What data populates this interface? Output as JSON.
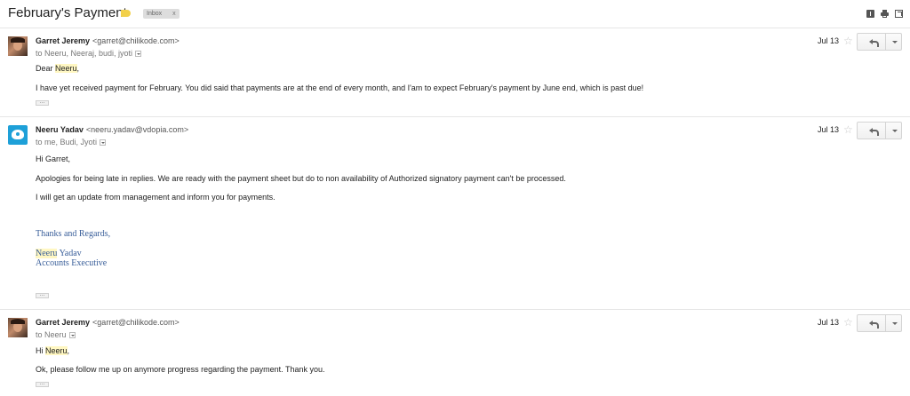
{
  "thread": {
    "subject": "February's Payment",
    "label_chip": "Inbox",
    "label_chip_close": "x",
    "label_color": "#f2d04a"
  },
  "toolbar_icons": [
    "info-icon",
    "print-icon",
    "new-window-icon"
  ],
  "messages": [
    {
      "sender_name": "Garret Jeremy",
      "sender_email": "<garret@chilikode.com>",
      "recipients": "to Neeru, Neeraj, budi, jyoti",
      "date": "Jul 13",
      "avatar": "user-photo",
      "body": {
        "greeting_pre": "Dear ",
        "greeting_name": "Neeru",
        "greeting_post": ",",
        "line1": "I have yet received payment for February. You did said that payments are at the end of every month, and I'am to expect February's payment by June end, which is past due!"
      },
      "ellipsis": "..."
    },
    {
      "sender_name": "Neeru Yadav",
      "sender_email": "<neeru.yadav@vdopia.com>",
      "recipients": "to me, Budi, Jyoti",
      "date": "Jul 13",
      "avatar": "company-logo",
      "body": {
        "greeting": "Hi Garret,",
        "line1": "Apologies for being late in replies. We are ready with the payment sheet but do to non availability of Authorized signatory payment can't be processed.",
        "line2": "I will get an update from management and inform you for payments.",
        "sig_regards": "Thanks and Regards,",
        "sig_first": "Neeru",
        "sig_last": " Yadav",
        "sig_title": "Accounts Executive"
      },
      "ellipsis": "..."
    },
    {
      "sender_name": "Garret Jeremy",
      "sender_email": "<garret@chilikode.com>",
      "recipients": "to Neeru",
      "date": "Jul 13",
      "avatar": "user-photo",
      "body": {
        "greeting_pre": "Hi ",
        "greeting_name": "Neeru",
        "greeting_post": ",",
        "line1": "Ok, please follow me up on anymore progress regarding the payment. Thank you."
      },
      "ellipsis": "..."
    }
  ],
  "star_glyph": "☆"
}
